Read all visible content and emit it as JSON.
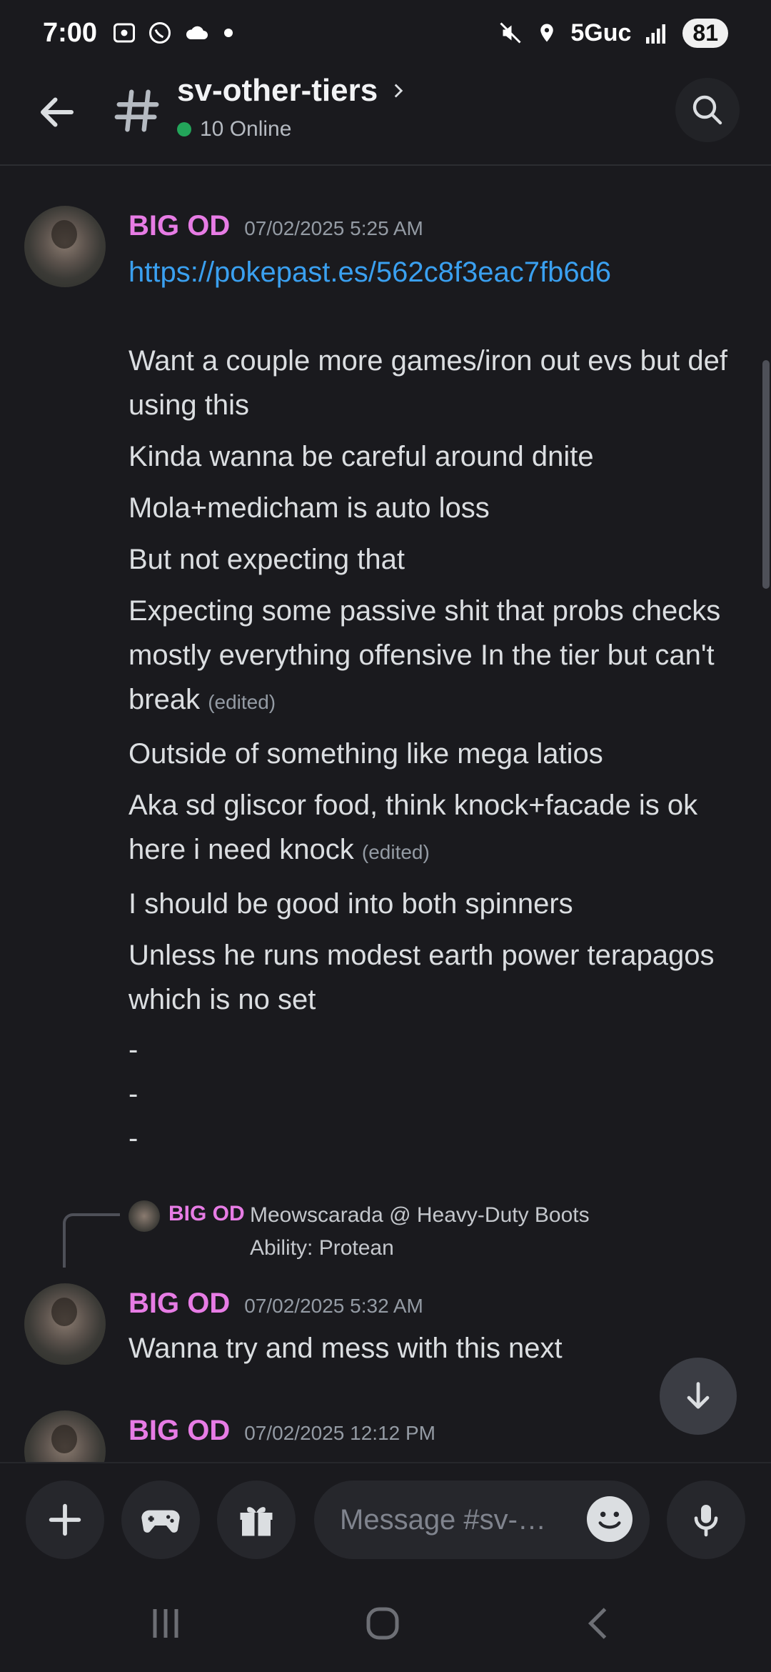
{
  "status_bar": {
    "time": "7:00",
    "network": "5Guc",
    "battery": "81"
  },
  "header": {
    "channel_name": "sv-other-tiers",
    "online": "10 Online"
  },
  "messages": [
    {
      "author": "BIG OD",
      "timestamp": "07/02/2025 5:25 AM",
      "link": "https://pokepast.es/562c8f3eac7fb6d6",
      "lines": [
        "Want a couple more games/iron out evs but def using this",
        "Kinda wanna be careful around dnite",
        "Mola+medicham is auto loss",
        "But not expecting that",
        "Expecting some passive shit that probs checks mostly everything  offensive In the tier but can't break",
        "Outside of something like mega latios",
        "Aka sd gliscor food, think knock+facade is ok here i need knock",
        "I should be good into both spinners",
        "Unless he runs modest earth power terapagos which is no set",
        "-",
        "-",
        "-"
      ],
      "edited_label": "(edited)"
    },
    {
      "reply": {
        "author": "BIG OD",
        "line1": "Meowscarada @ Heavy-Duty Boots",
        "line2": "Ability: Protean"
      },
      "author": "BIG OD",
      "timestamp": "07/02/2025 5:32 AM",
      "text": "Wanna try and mess with this next"
    },
    {
      "author": "BIG OD",
      "timestamp": "07/02/2025 12:12 PM"
    }
  ],
  "composer": {
    "placeholder": "Message #sv-…"
  },
  "colors": {
    "author": "#e77ce5",
    "link": "#3aa0f0",
    "online": "#23a55a",
    "background": "#1a1a1e"
  }
}
